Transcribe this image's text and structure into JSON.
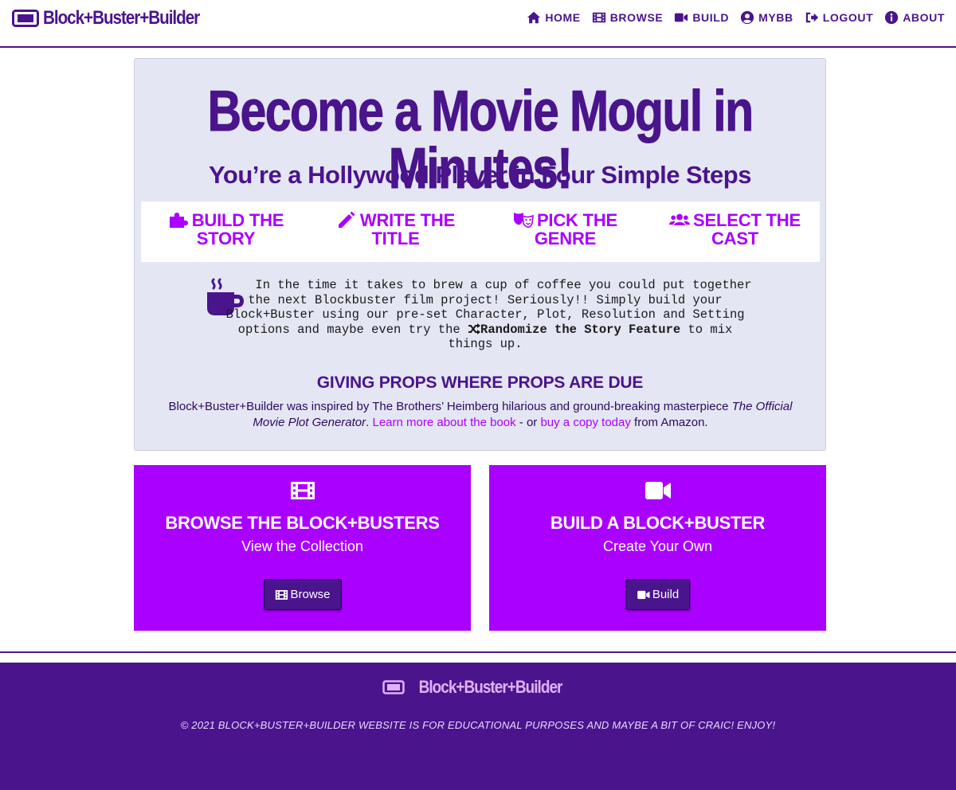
{
  "brand": {
    "name": "Block+Buster+Builder"
  },
  "nav": [
    {
      "label": "HOME",
      "icon": "home-icon"
    },
    {
      "label": "BROWSE",
      "icon": "film-icon"
    },
    {
      "label": "BUILD",
      "icon": "video-icon"
    },
    {
      "label": "MYBB",
      "icon": "user-circle-icon"
    },
    {
      "label": "LOGOUT",
      "icon": "sign-out-icon"
    },
    {
      "label": "ABOUT",
      "icon": "info-circle-icon"
    }
  ],
  "hero": {
    "title": "Become a Movie Mogul in Minutes!",
    "subtitle": "You’re a Hollywood Player in Four Simple Steps",
    "steps": [
      {
        "line1": "BUILD THE",
        "line2": "STORY",
        "icon": "puzzle-icon"
      },
      {
        "line1": "WRITE THE",
        "line2": "TITLE",
        "icon": "pencil-icon"
      },
      {
        "line1": "PICK THE",
        "line2": "GENRE",
        "icon": "theater-masks-icon"
      },
      {
        "line1": "SELECT THE",
        "line2": "CAST",
        "icon": "users-icon"
      }
    ],
    "intro": {
      "part1": "In the time it takes to brew a cup of coffee you could put together the next Blockbuster film project! Seriously!! Simply build your Block+Buster using our pre-set Character, Plot, Resolution and Setting options and maybe even try the ",
      "feature": "Randomize the Story Feature",
      "part2": " to mix things up."
    },
    "props_title": "GIVING PROPS WHERE PROPS ARE DUE",
    "props": {
      "text1": "Block+Buster+Builder was inspired by The Brothers’ Heimberg hilarious and ground-breaking masterpiece ",
      "book_title": "The Official Movie Plot Generator",
      "text2": ". ",
      "link1": "Learn more about the book",
      "text3": " - or ",
      "link2": "buy a copy today",
      "text4": " from Amazon."
    }
  },
  "cards": [
    {
      "title": "BROWSE THE BLOCK+BUSTERS",
      "subtitle": "View the Collection",
      "button": "Browse",
      "icon": "film-icon"
    },
    {
      "title": "BUILD A BLOCK+BUSTER",
      "subtitle": "Create Your Own",
      "button": "Build",
      "icon": "video-icon"
    }
  ],
  "footer": {
    "brand": "Block+Buster+Builder",
    "copyright": "© 2021 BLOCK+BUSTER+BUILDER WEBSITE IS FOR EDUCATIONAL PURPOSES AND MAYBE A BIT OF CRAIC! ENJOY!"
  },
  "colors": {
    "primary": "#4a148c",
    "accent": "#aa00ff",
    "hero_bg": "#e4e6f4",
    "footer_brand": "#e0b3ff"
  }
}
